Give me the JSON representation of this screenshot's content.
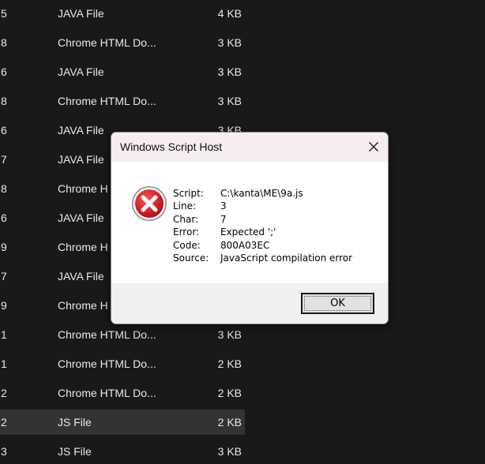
{
  "file_rows": [
    {
      "num": "5",
      "type": "JAVA File",
      "size": "4 KB"
    },
    {
      "num": "8",
      "type": "Chrome HTML Do...",
      "size": "3 KB"
    },
    {
      "num": "6",
      "type": "JAVA File",
      "size": "3 KB"
    },
    {
      "num": "8",
      "type": "Chrome HTML Do...",
      "size": "3 KB"
    },
    {
      "num": "6",
      "type": "JAVA File",
      "size": "3 KB"
    },
    {
      "num": "7",
      "type": "JAVA File",
      "size": ""
    },
    {
      "num": "8",
      "type": "Chrome H",
      "size": ""
    },
    {
      "num": "6",
      "type": "JAVA File",
      "size": ""
    },
    {
      "num": "9",
      "type": "Chrome H",
      "size": ""
    },
    {
      "num": "7",
      "type": "JAVA File",
      "size": ""
    },
    {
      "num": "9",
      "type": "Chrome H",
      "size": ""
    },
    {
      "num": "1",
      "type": "Chrome HTML Do...",
      "size": "3 KB"
    },
    {
      "num": "1",
      "type": "Chrome HTML Do...",
      "size": "2 KB"
    },
    {
      "num": "2",
      "type": "Chrome HTML Do...",
      "size": "2 KB"
    },
    {
      "num": "2",
      "type": "JS File",
      "size": "2 KB",
      "selected": true
    },
    {
      "num": "3",
      "type": "JS File",
      "size": "3 KB"
    }
  ],
  "dialog": {
    "title": "Windows Script Host",
    "icon": "error-icon",
    "details": [
      {
        "label": "Script:",
        "value": "C:\\kanta\\ME\\9a.js"
      },
      {
        "label": "Line:",
        "value": "3"
      },
      {
        "label": "Char:",
        "value": "7"
      },
      {
        "label": "Error:",
        "value": "Expected ';'"
      },
      {
        "label": "Code:",
        "value": "800A03EC"
      },
      {
        "label": "Source:",
        "value": "JavaScript compilation error"
      }
    ],
    "ok_label": "OK"
  },
  "colors": {
    "background": "#191919",
    "title_bar": "#f7edf1",
    "error_red": "#d8232a"
  }
}
